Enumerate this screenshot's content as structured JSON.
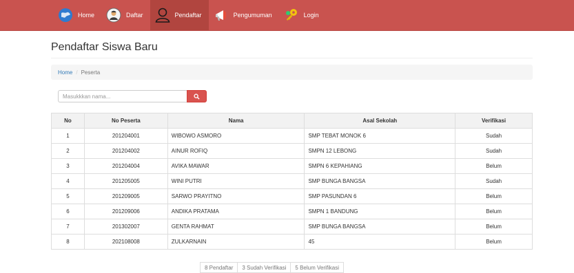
{
  "nav": {
    "items": [
      {
        "label": "Home",
        "icon": "globe-icon"
      },
      {
        "label": "Daftar",
        "icon": "user-avatar-icon"
      },
      {
        "label": "Pendaftar",
        "icon": "person-outline-icon",
        "active": true
      },
      {
        "label": "Pengumuman",
        "icon": "megaphone-icon"
      },
      {
        "label": "Login",
        "icon": "key-icon"
      }
    ]
  },
  "page": {
    "title": "Pendaftar Siswa Baru"
  },
  "breadcrumb": {
    "home": "Home",
    "separator": "/",
    "current": "Peserta"
  },
  "search": {
    "placeholder": "Masukkkan nama..."
  },
  "table": {
    "headers": [
      "No",
      "No Peserta",
      "Nama",
      "Asal Sekolah",
      "Verifikasi"
    ],
    "rows": [
      [
        "1",
        "201204001",
        "WIBOWO ASMORO",
        "SMP TEBAT MONOK 6",
        "Sudah"
      ],
      [
        "2",
        "201204002",
        "AINUR ROFIQ",
        "SMPN 12 LEBONG",
        "Sudah"
      ],
      [
        "3",
        "201204004",
        "AVIKA MAWAR",
        "SMPN 6 KEPAHIANG",
        "Belum"
      ],
      [
        "4",
        "201205005",
        "WINI PUTRI",
        "SMP BUNGA BANGSA",
        "Sudah"
      ],
      [
        "5",
        "201209005",
        "SARWO PRAYITNO",
        "SMP PASUNDAN 6",
        "Belum"
      ],
      [
        "6",
        "201209006",
        "ANDIKA PRATAMA",
        "SMPN 1 BANDUNG",
        "Belum"
      ],
      [
        "7",
        "201302007",
        "GENTA RAHMAT",
        "SMP BUNGA BANGSA",
        "Belum"
      ],
      [
        "8",
        "202108008",
        "ZULKARNAIN",
        "45",
        "Belum"
      ]
    ]
  },
  "summary": {
    "total": "8 Pendaftar",
    "verified": "3 Sudah Verifikasi",
    "unverified": "5 Belum Verifikasi"
  },
  "colors": {
    "navbar": "#c9534f",
    "active": "#b1453f",
    "button": "#d9534f"
  }
}
